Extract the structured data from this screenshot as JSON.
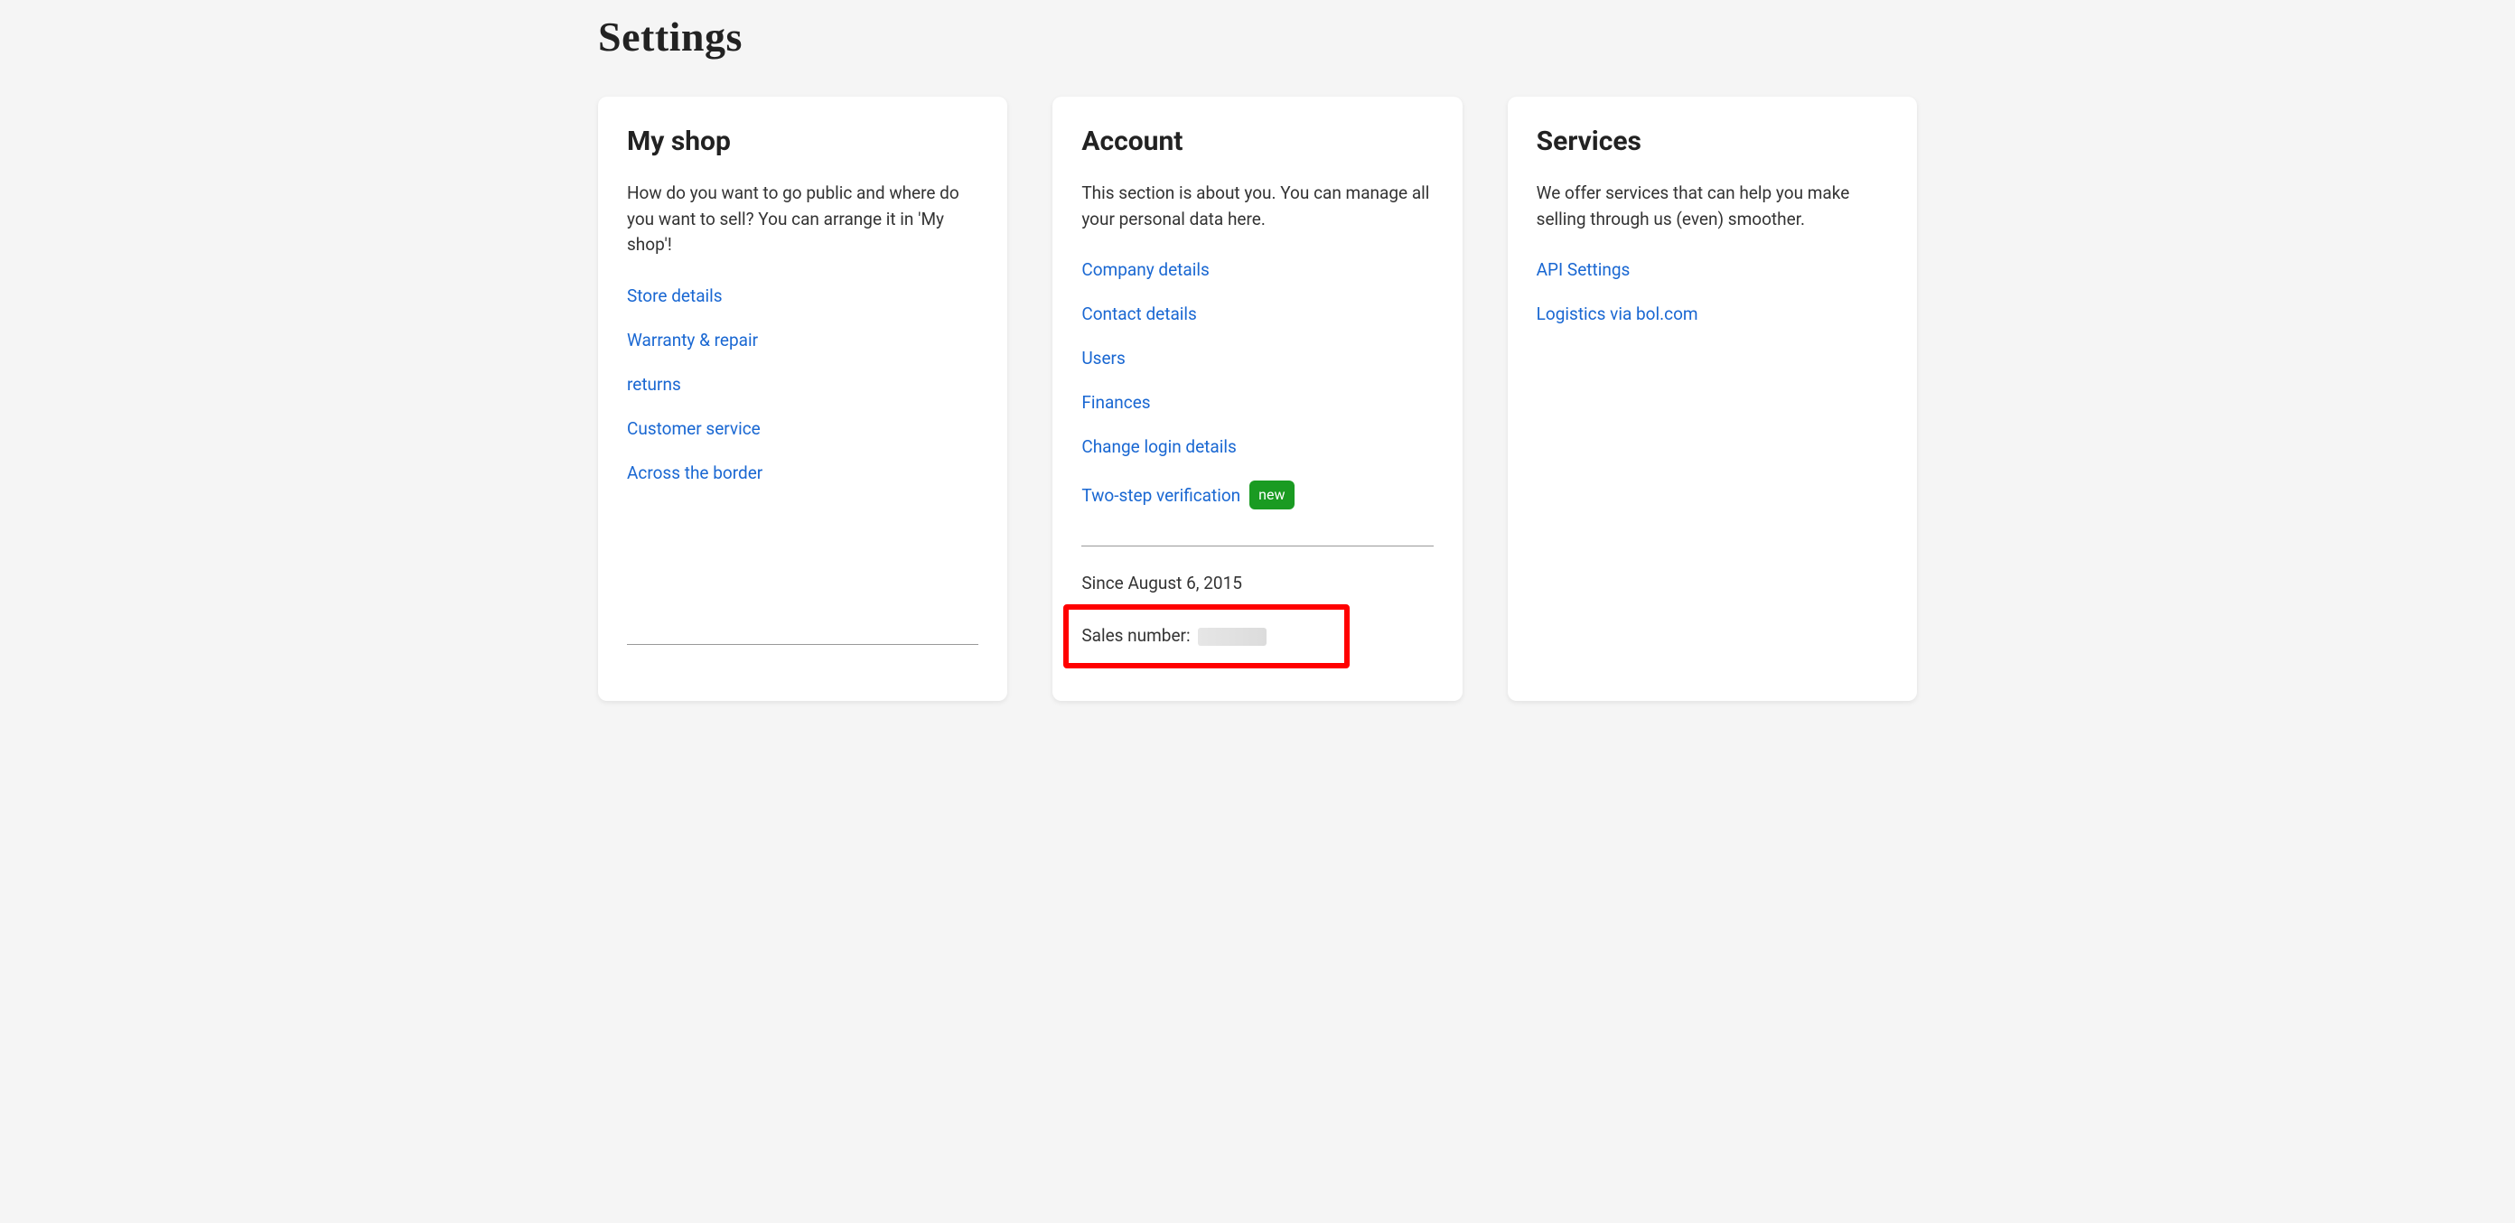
{
  "pageTitle": "Settings",
  "shop": {
    "heading": "My shop",
    "description": "How do you want to go public and where do you want to sell? You can arrange it in 'My shop'!",
    "links": {
      "store_details": "Store details",
      "warranty_repair": "Warranty & repair",
      "returns": "returns",
      "customer_service": "Customer service",
      "across_border": "Across the border"
    }
  },
  "account": {
    "heading": "Account",
    "description": "This section is about you. You can manage all your personal data here.",
    "links": {
      "company_details": "Company details",
      "contact_details": "Contact details",
      "users": "Users",
      "finances": "Finances",
      "change_login": "Change login details",
      "two_step": "Two-step verification"
    },
    "badge_new": "new",
    "since_text": "Since August 6, 2015",
    "sales_label": "Sales number:"
  },
  "services": {
    "heading": "Services",
    "description": "We offer services that can help you make selling through us (even) smoother.",
    "links": {
      "api_settings": "API Settings",
      "logistics": "Logistics via bol.com"
    }
  }
}
